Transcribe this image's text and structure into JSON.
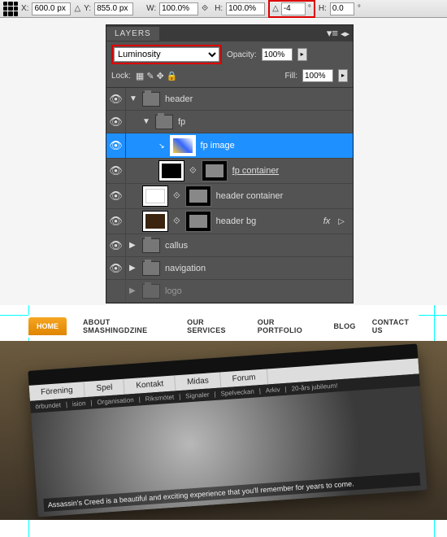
{
  "options_bar": {
    "x_label": "X:",
    "x_value": "600.0 px",
    "delta_label": "△",
    "y_label": "Y:",
    "y_value": "855.0 px",
    "w_label": "W:",
    "w_value": "100.0%",
    "h_label": "H:",
    "h_value": "100.0%",
    "angle_label": "△",
    "angle_value": "-4",
    "angle_unit": "°",
    "skew_h_label": "H:",
    "skew_h_value": "0.0",
    "skew_h_unit": "°"
  },
  "panel": {
    "title": "LAYERS",
    "blend_mode": "Luminosity",
    "opacity_label": "Opacity:",
    "opacity_value": "100%",
    "lock_label": "Lock:",
    "fill_label": "Fill:",
    "fill_value": "100%"
  },
  "layers": {
    "header": "header",
    "fp": "fp",
    "fp_image": "fp image",
    "fp_container": "fp container",
    "header_container": "header container",
    "header_bg": "header bg",
    "fx": "fx",
    "callus": "callus",
    "navigation": "navigation",
    "logo": "logo"
  },
  "site": {
    "nav": [
      "HOME",
      "ABOUT SMASHINGDZINE",
      "OUR SERVICES",
      "OUR PORTFOLIO",
      "BLOG",
      "CONTACT US"
    ],
    "fp_tabs": [
      "Förening",
      "Spel",
      "Kontakt",
      "Midas",
      "Forum"
    ],
    "fp_sub": [
      "örbundet",
      "ision",
      "Organisation",
      "Riksmötet",
      "Signaler",
      "Spelveckan",
      "Arkiv",
      "20-års jubileum!"
    ],
    "fp_caption": "Assassin's Creed is a beautiful and exciting experience that you'll remember for years to come."
  }
}
